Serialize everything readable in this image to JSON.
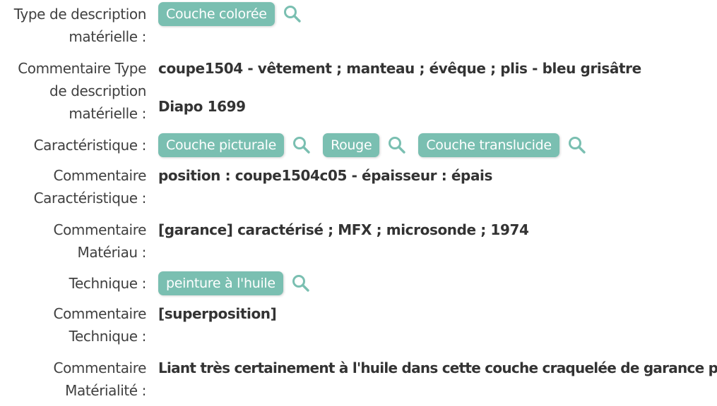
{
  "fields": [
    {
      "label": "Type de description matérielle :",
      "tags": [
        "Couche colorée"
      ]
    },
    {
      "label": "Commentaire Type de description matérielle :",
      "lines": [
        "coupe1504 - vêtement ; manteau ; évêque ; plis - bleu grisâtre",
        "Diapo 1699"
      ]
    },
    {
      "label": "Caractéristique :",
      "tags": [
        "Couche picturale",
        "Rouge",
        "Couche translucide"
      ]
    },
    {
      "label": "Commentaire Caractéristique :",
      "lines": [
        "position : coupe1504c05 - épaisseur : épais"
      ]
    },
    {
      "label": "Commentaire Matériau :",
      "lines": [
        "[garance] caractérisé ; MFX ; microsonde ; 1974"
      ]
    },
    {
      "label": "Technique :",
      "tags": [
        "peinture à l'huile"
      ]
    },
    {
      "label": "Commentaire Technique :",
      "lines": [
        "[superposition]"
      ]
    },
    {
      "label": "Commentaire Matérialité :",
      "lines": [
        "Liant très certainement à l'huile dans cette couche craquelée de garance pure"
      ]
    }
  ],
  "icons": {
    "search": "search-icon"
  },
  "colors": {
    "tag_background": "#7abfb1",
    "tag_text": "#ffffff",
    "search_icon": "#7abfb1",
    "label_text": "#404040",
    "value_text": "#333333"
  }
}
